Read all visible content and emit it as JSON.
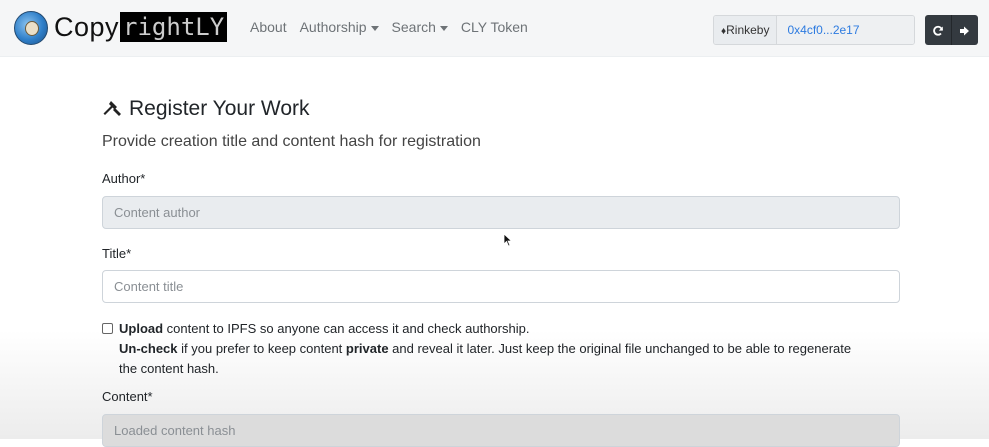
{
  "navbar": {
    "logo_plain": "Copy",
    "logo_dark": "rightLY",
    "links": [
      "About",
      "Authorship",
      "Search",
      "CLY Token"
    ],
    "network": "Rinkeby",
    "network_icon": "ethereum-icon",
    "address": "0x4cf0...2e17",
    "refresh_icon": "refresh-icon",
    "signout_icon": "sign-out-icon"
  },
  "main": {
    "title": "Register Your Work",
    "title_icon": "gavel-icon",
    "subtitle": "Provide creation title and content hash for registration",
    "author_label": "Author*",
    "author_placeholder": "Content author",
    "title_label": "Title*",
    "title_placeholder": "Content title",
    "upload": {
      "bold1": "Upload",
      "text1": " content to IPFS so anyone can access it and check authorship.",
      "bold2": "Un-check",
      "text2": " if you prefer to keep content ",
      "bold3": "private",
      "text3": " and reveal it later. Just keep the original file unchanged to be able to regenerate the content hash."
    },
    "content_label": "Content*",
    "content_placeholder": "Loaded content hash"
  }
}
